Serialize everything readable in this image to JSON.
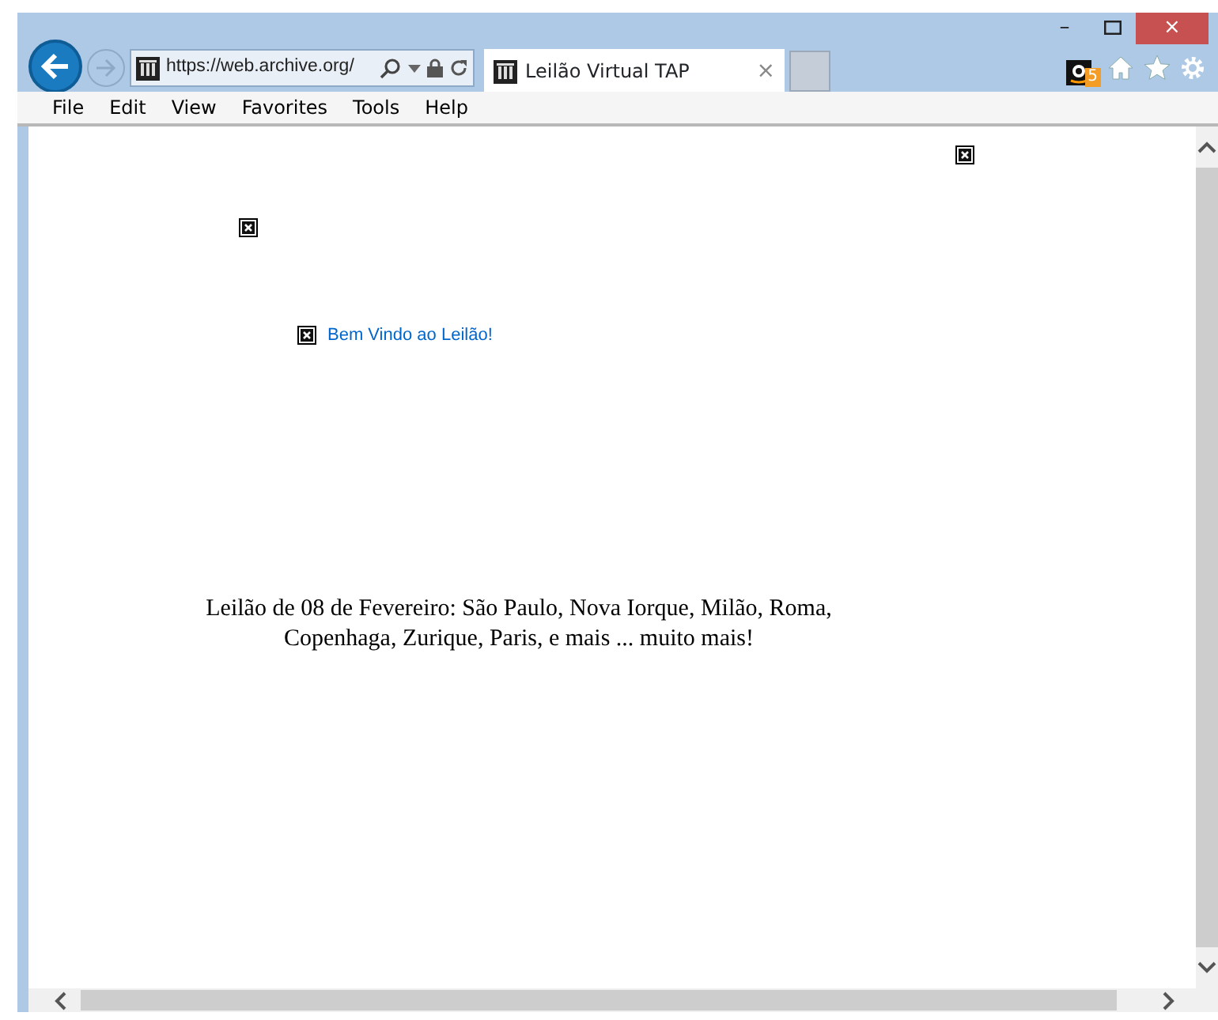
{
  "window": {
    "minimize": "–",
    "close": "×"
  },
  "address_bar": {
    "url": "https://web.archive.org/"
  },
  "tabs": [
    {
      "title": "Leilão Virtual TAP",
      "selected": true,
      "close": "×"
    }
  ],
  "toolbar": {
    "badge": "5"
  },
  "menu": [
    "File",
    "Edit",
    "View",
    "Favorites",
    "Tools",
    "Help"
  ],
  "page": {
    "link": "Bem Vindo ao Leilão!",
    "announcement": "Leilão de 08 de Fevereiro: São Paulo, Nova Iorque, Milão, Roma, Copenhaga, Zurique, Paris, e mais ... muito mais!"
  }
}
